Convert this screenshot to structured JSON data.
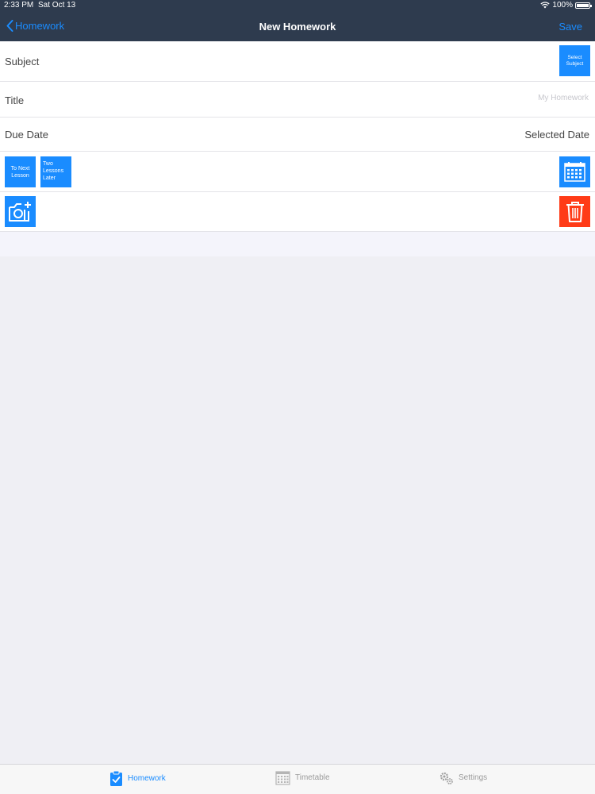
{
  "status_bar": {
    "time": "2:33 PM",
    "date": "Sat Oct 13",
    "battery": "100%"
  },
  "nav": {
    "back_label": "Homework",
    "title": "New Homework",
    "save_label": "Save"
  },
  "form": {
    "subject_label": "Subject",
    "select_subject_label": "Select Subject",
    "title_label": "Title",
    "title_value": "",
    "title_placeholder": "My Homework",
    "due_date_label": "Due Date",
    "due_date_value": "Selected Date",
    "to_next_lesson_label": "To Next Lesson",
    "two_lessons_later_label": "Two Lessons Later"
  },
  "tabs": [
    {
      "label": "Homework",
      "icon": "clipboard-check-icon",
      "active": true
    },
    {
      "label": "Timetable",
      "icon": "calendar-grid-icon",
      "active": false
    },
    {
      "label": "Settings",
      "icon": "gear-icon",
      "active": false
    }
  ],
  "colors": {
    "accent": "#1a8cff",
    "nav_background": "#2e3b4e",
    "delete": "#ff3b17",
    "inactive_tab": "#9b9b9b"
  }
}
